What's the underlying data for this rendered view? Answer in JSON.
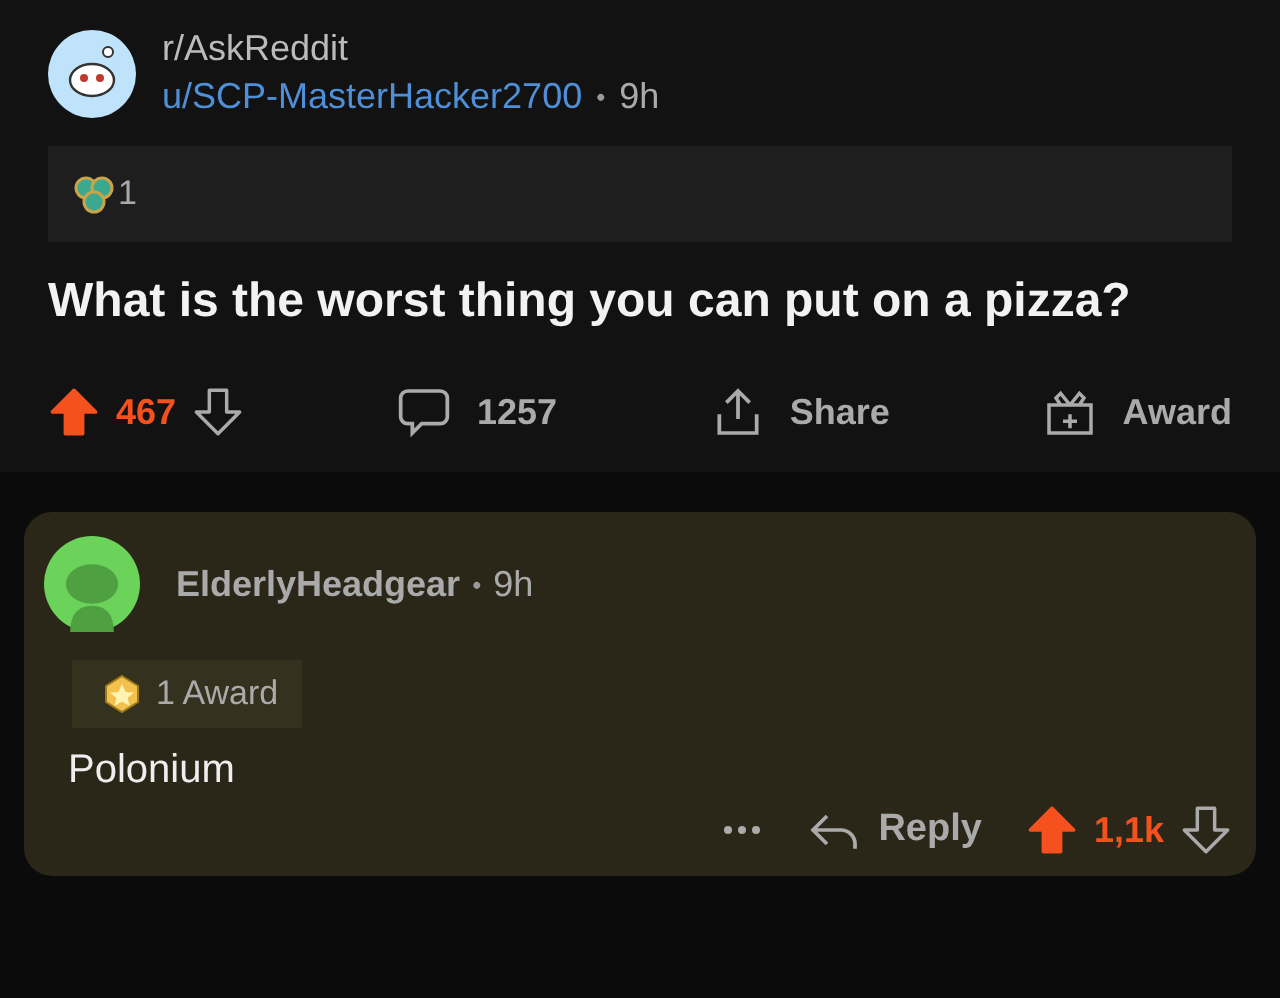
{
  "post": {
    "subreddit": "r/AskReddit",
    "author": "u/SCP-MasterHacker2700",
    "separator": "•",
    "age": "9h",
    "award_count": "1",
    "title": "What is the worst thing you can put on a pizza?",
    "upvoted": true,
    "score": "467",
    "comments": "1257",
    "share": "Share",
    "award": "Award"
  },
  "comment": {
    "author": "ElderlyHeadgear",
    "separator": "•",
    "age": "9h",
    "award_label": "1 Award",
    "body": "Polonium",
    "reply": "Reply",
    "upvoted": true,
    "score": "1,1k"
  }
}
